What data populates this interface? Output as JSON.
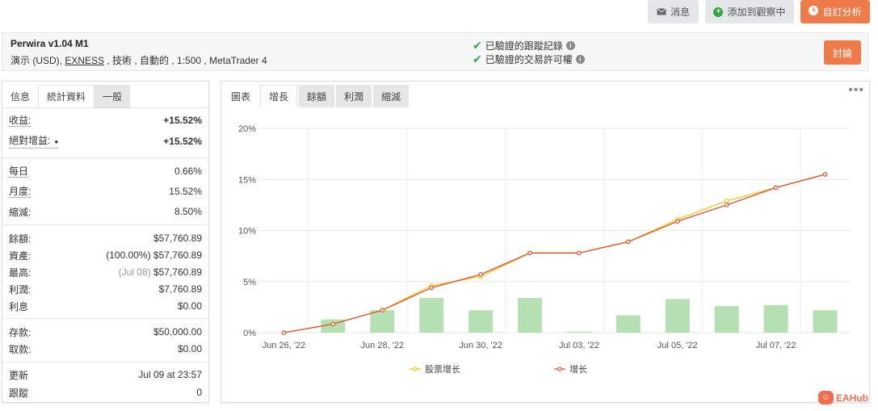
{
  "toolbar": {
    "message": "消息",
    "add_watch": "添加到觀察中",
    "custom_analysis": "自訂分析"
  },
  "system": {
    "name": "Perwira v1.04 M1",
    "sub_prefix": "演示 (USD), ",
    "broker": "EXNESS",
    "sub_suffix": " , 技術 , 自動的 , 1:500 , MetaTrader 4",
    "verified_track": "已驗證的跟蹤記錄",
    "verified_trading": "已驗證的交易許可權",
    "discuss": "討論"
  },
  "left_tabs": [
    "信息",
    "統計資料",
    "一般"
  ],
  "stats": {
    "gain_label": "收益:",
    "gain_value": "+15.52%",
    "abs_gain_label": "絕對增益:",
    "abs_gain_value": "+15.52%",
    "daily_label": "每日",
    "daily_value": "0.66%",
    "monthly_label": "月度:",
    "monthly_value": "15.52%",
    "drawdown_label": "縮減:",
    "drawdown_value": "8.50%",
    "balance_label": "餘額:",
    "balance_value": "$57,760.89",
    "equity_label": "資產:",
    "equity_value": "(100.00%) $57,760.89",
    "highest_label": "最高:",
    "highest_date": "(Jul 08)",
    "highest_value": "$57,760.89",
    "profit_label": "利潤:",
    "profit_value": "$7,760.89",
    "interest_label": "利息",
    "interest_value": "$0.00",
    "deposits_label": "存款:",
    "deposits_value": "$50,000.00",
    "withdrawals_label": "取款:",
    "withdrawals_value": "$0.00",
    "updated_label": "更新",
    "updated_value": "Jul 09 at 23:57",
    "tracking_label": "跟蹤",
    "tracking_value": "0"
  },
  "right_tabs": [
    "圖表",
    "增長",
    "餘額",
    "利潤",
    "縮減"
  ],
  "colors": {
    "accent_orange": "#f07b4a",
    "verified_green": "#2eaa3f",
    "growth_line": "#e0502a",
    "equity_line": "#f2c41c",
    "bar_green": "#b5e0b3"
  },
  "watermark": "EAHub",
  "chart_data": {
    "type": "line",
    "x_tick_labels": [
      "Jun 26, '22",
      "Jun 28, '22",
      "Jun 30, '22",
      "Jul 03, '22",
      "Jul 05, '22",
      "Jul 07, '22"
    ],
    "y_tick_labels": [
      "0%",
      "5%",
      "10%",
      "15%",
      "20%"
    ],
    "ylim": [
      0,
      20
    ],
    "grid": true,
    "legend_position": "bottom",
    "points": 12,
    "series": [
      {
        "name": "股票增长",
        "color": "#f2c41c",
        "values": [
          0,
          0.85,
          2.2,
          4.6,
          5.5,
          7.8,
          7.8,
          8.9,
          11.1,
          12.9,
          14.2,
          15.5
        ]
      },
      {
        "name": "增长",
        "color": "#e0502a",
        "values": [
          0,
          0.85,
          2.2,
          4.4,
          5.7,
          7.8,
          7.8,
          8.9,
          10.9,
          12.5,
          14.2,
          15.5
        ]
      }
    ],
    "bars": {
      "color": "#b5e0b3",
      "values": [
        0,
        1.3,
        2.2,
        3.4,
        2.2,
        3.4,
        0.1,
        1.7,
        3.3,
        2.6,
        2.7,
        2.2
      ]
    }
  }
}
